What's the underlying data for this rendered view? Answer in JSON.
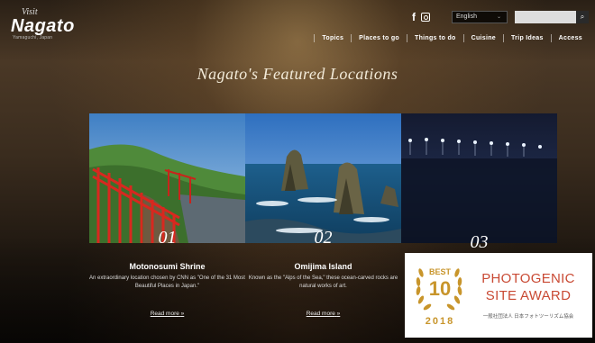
{
  "header": {
    "logo": {
      "small": "Visit",
      "main": "Nagato",
      "sub": "Yamaguchi, Japan"
    },
    "social": [
      {
        "icon": "facebook-icon"
      },
      {
        "icon": "instagram-icon"
      }
    ],
    "language": {
      "selected": "English"
    },
    "search": {
      "placeholder": ""
    },
    "nav": [
      "Topics",
      "Places to go",
      "Things to do",
      "Cuisine",
      "Trip Ideas",
      "Access"
    ]
  },
  "main": {
    "title": "Nagato's Featured Locations",
    "cards": [
      {
        "num": "01",
        "title": "Motonosumi Shrine",
        "desc": "An extraordinary location chosen by CNN as \"One of the 31 Most Beautiful Places in Japan.\"",
        "more": "Read more"
      },
      {
        "num": "02",
        "title": "Omijima Island",
        "desc": "Known as the \"Alps of the Sea,\" these ocean-carved rocks are natural works of art.",
        "more": "Read more"
      },
      {
        "num": "03"
      }
    ]
  },
  "award": {
    "best": "BEST",
    "rank": "10",
    "year": "2018",
    "line1": "PHOTOGENIC",
    "line2": "SITE AWARD",
    "org": "一般社団法人 日本フォトツーリズム協会"
  },
  "colors": {
    "award_gold": "#c8952b",
    "award_red": "#c94a34"
  }
}
